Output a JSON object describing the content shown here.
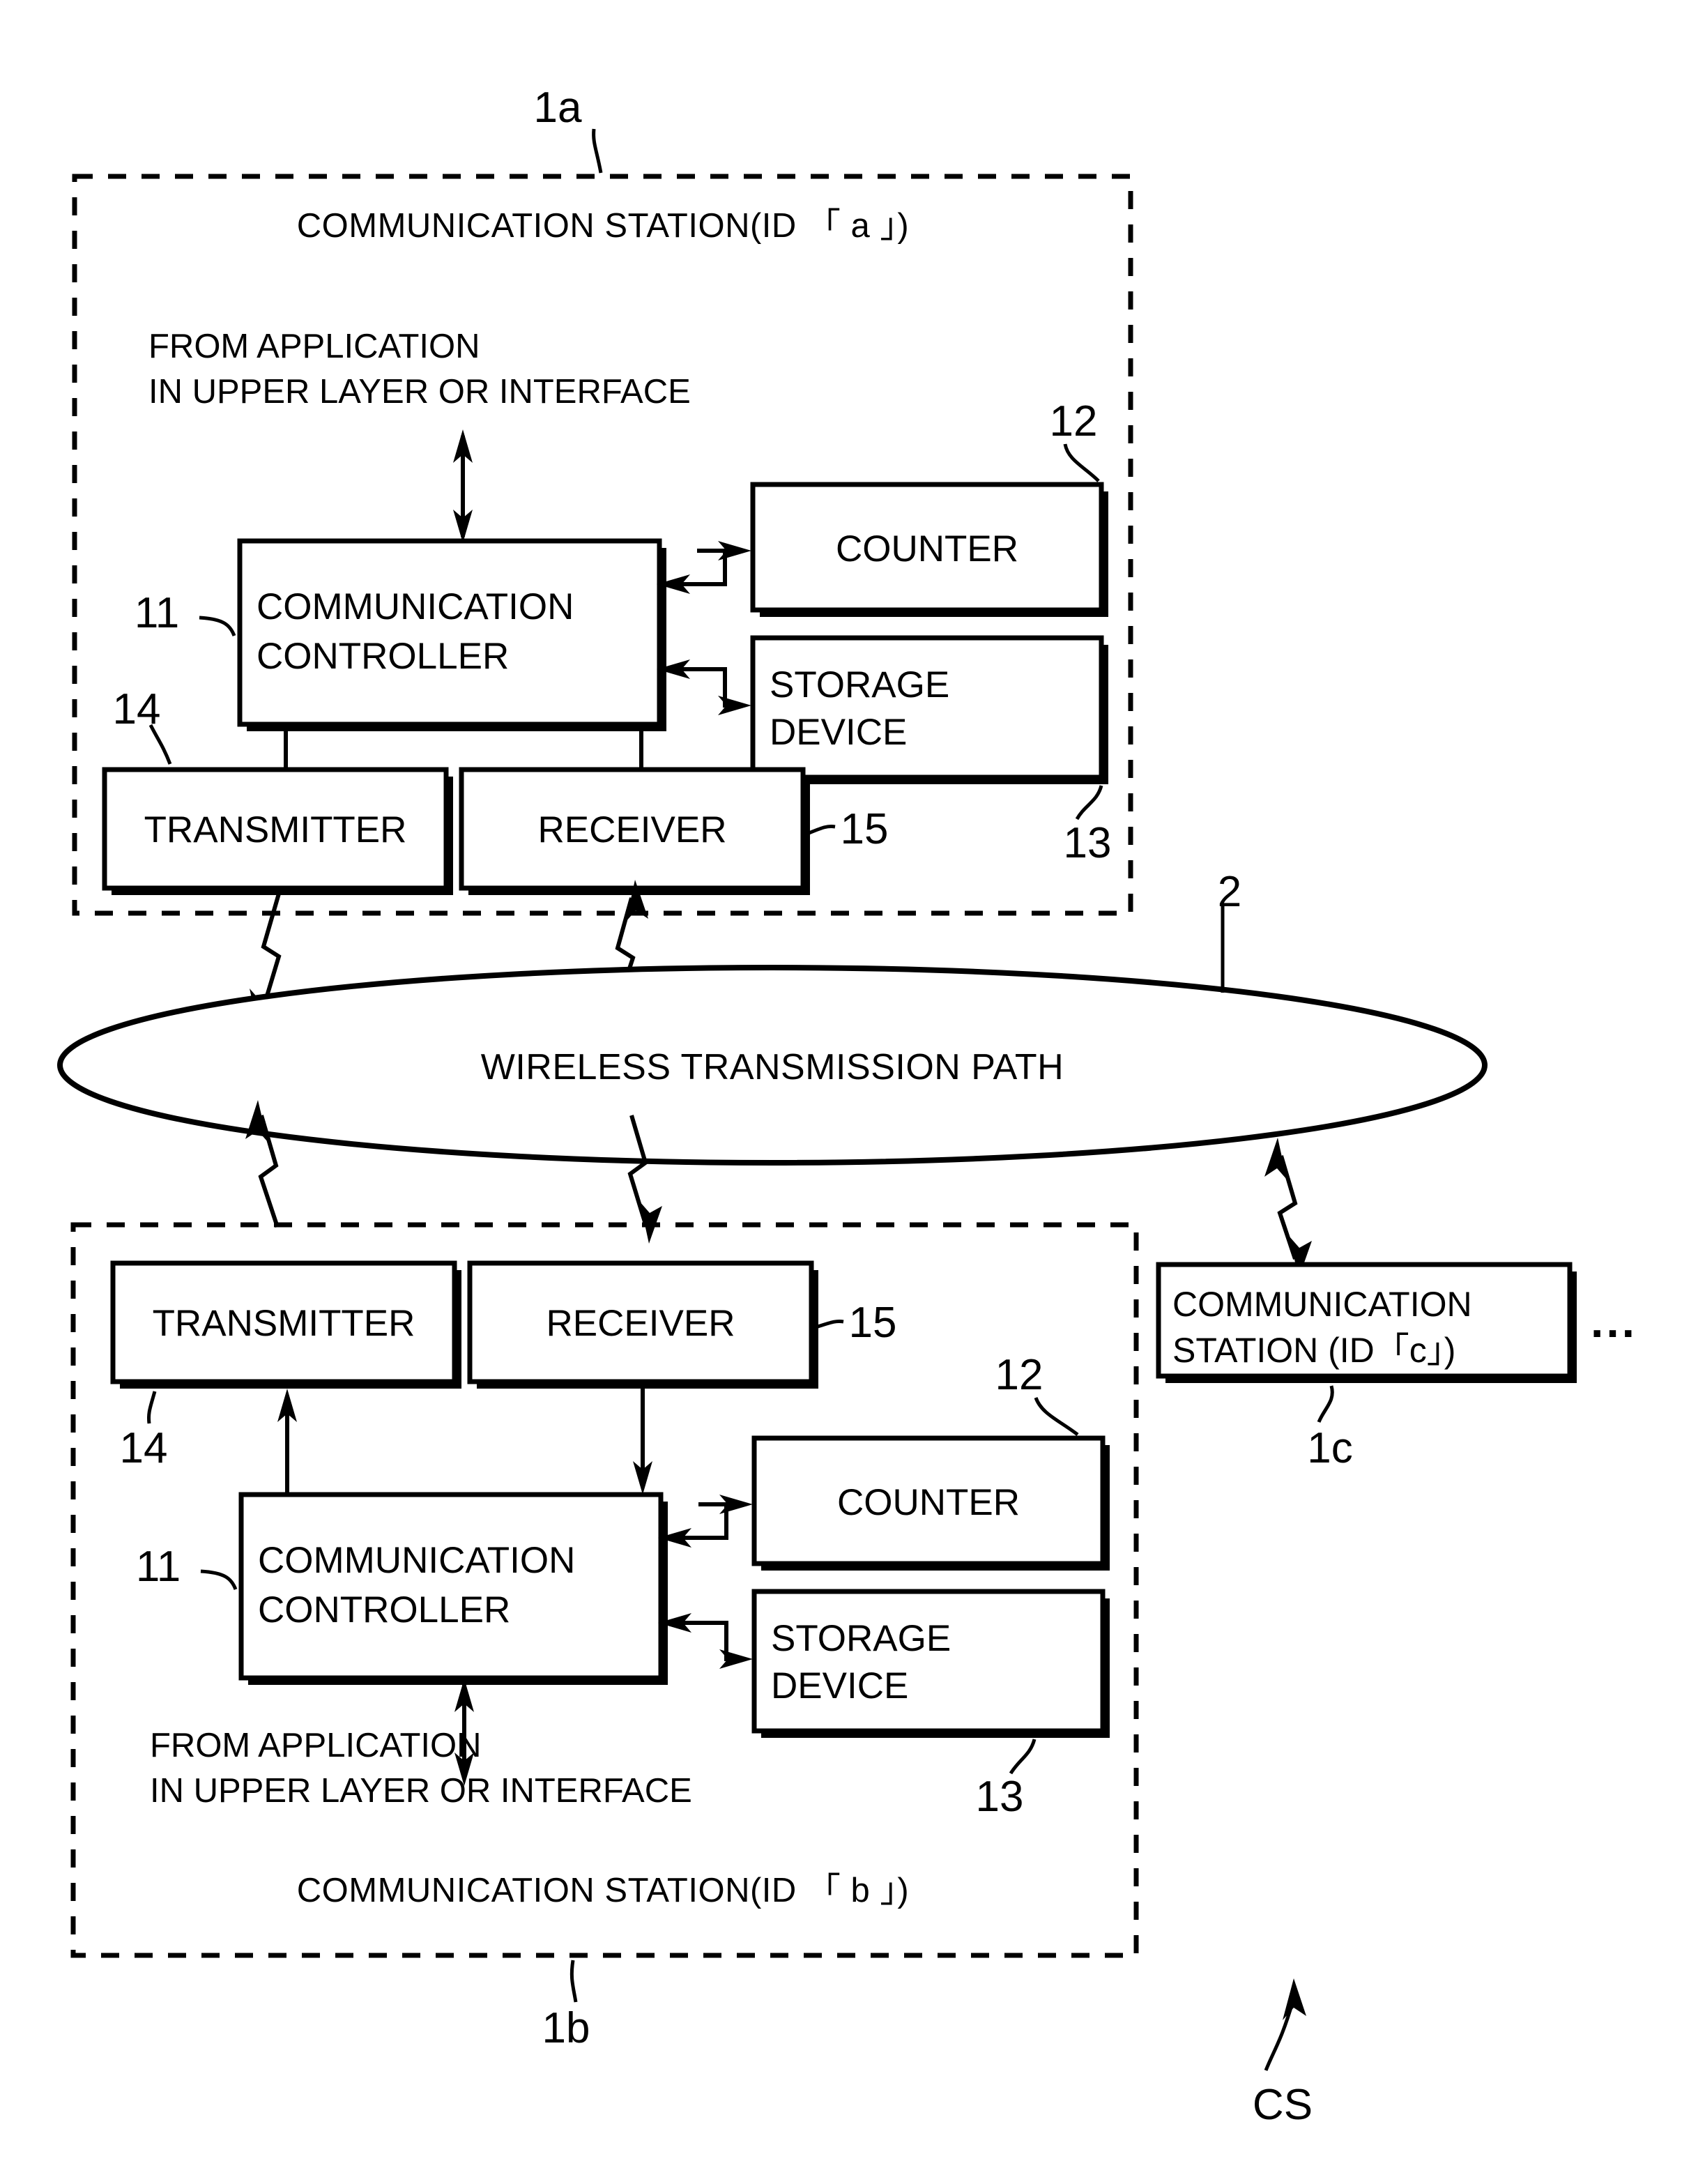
{
  "figure": {
    "background_color": "#ffffff",
    "line_color": "#000000"
  },
  "station_a": {
    "ref_label": "1a",
    "title": "COMMUNICATION STATION(ID 「 a 」)",
    "upper_layer_note_line1": "FROM APPLICATION",
    "upper_layer_note_line2": "IN UPPER LAYER OR INTERFACE",
    "blocks": {
      "controller": {
        "ref": "11",
        "line1": "COMMUNICATION",
        "line2": "CONTROLLER"
      },
      "counter": {
        "ref": "12",
        "label": "COUNTER"
      },
      "storage": {
        "ref": "13",
        "line1": "STORAGE",
        "line2": "DEVICE"
      },
      "transmitter": {
        "ref": "14",
        "label": "TRANSMITTER"
      },
      "receiver": {
        "ref": "15",
        "label": "RECEIVER"
      }
    }
  },
  "transmission_path": {
    "ref_label": "2",
    "label": "WIRELESS TRANSMISSION PATH"
  },
  "station_b": {
    "ref_label": "1b",
    "title": "COMMUNICATION STATION(ID 「 b 」)",
    "upper_layer_note_line1": "FROM APPLICATION",
    "upper_layer_note_line2": "IN UPPER LAYER OR INTERFACE",
    "blocks": {
      "controller": {
        "ref": "11",
        "line1": "COMMUNICATION",
        "line2": "CONTROLLER"
      },
      "counter": {
        "ref": "12",
        "label": "COUNTER"
      },
      "storage": {
        "ref": "13",
        "line1": "STORAGE",
        "line2": "DEVICE"
      },
      "transmitter": {
        "ref": "14",
        "label": "TRANSMITTER"
      },
      "receiver": {
        "ref": "15",
        "label": "RECEIVER"
      }
    }
  },
  "station_c": {
    "ref_label": "1c",
    "line1": "COMMUNICATION",
    "line2": "STATION (ID「c」)",
    "ellipsis": "..."
  },
  "system": {
    "ref_label": "CS"
  }
}
